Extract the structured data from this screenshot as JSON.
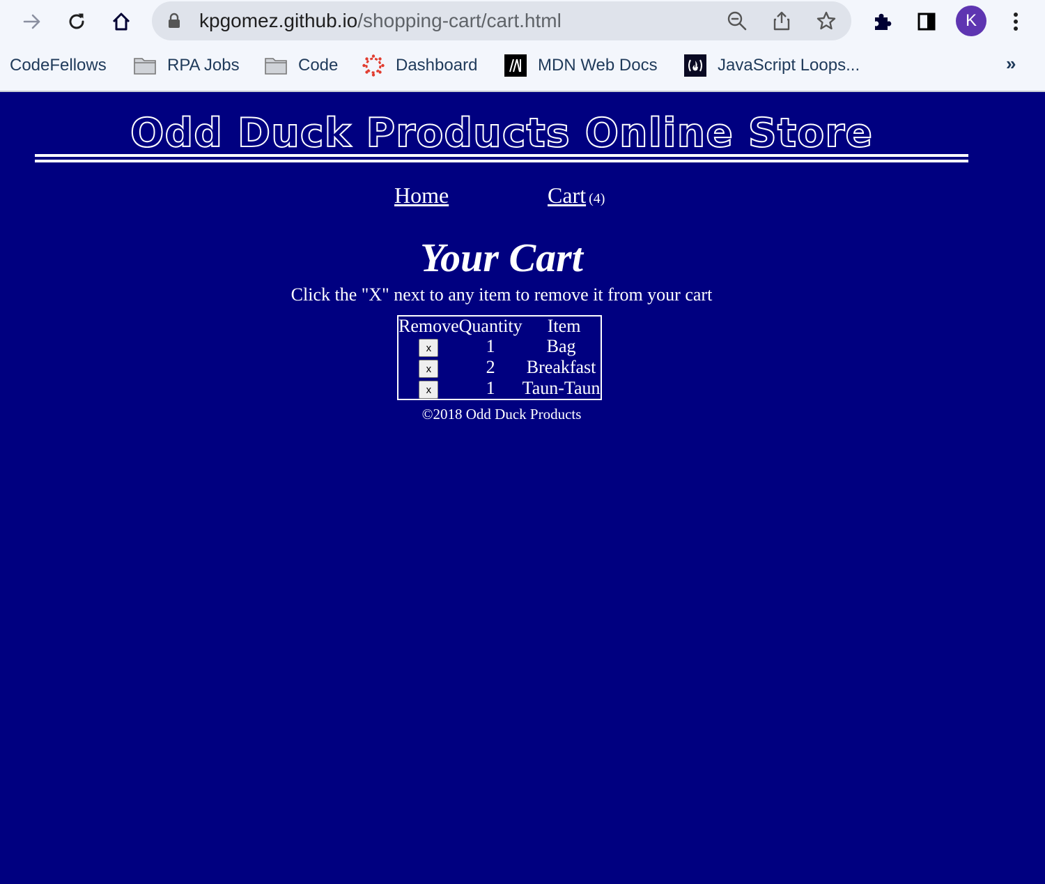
{
  "browser": {
    "url_host": "kpgomez.github.io",
    "url_path": "/shopping-cart/cart.html",
    "profile_initial": "K",
    "bookmarks": [
      {
        "label": "CodeFellows",
        "icon": "none"
      },
      {
        "label": "RPA Jobs",
        "icon": "folder-icon"
      },
      {
        "label": "Code",
        "icon": "folder-icon"
      },
      {
        "label": "Dashboard",
        "icon": "canvas-logo-icon"
      },
      {
        "label": "MDN Web Docs",
        "icon": "mdn-logo-icon"
      },
      {
        "label": "JavaScript Loops...",
        "icon": "freecodecamp-logo-icon"
      }
    ],
    "more_bookmarks": "»"
  },
  "page": {
    "banner": "Odd Duck Products Online Store",
    "nav": {
      "home": "Home",
      "cart": "Cart",
      "cart_count": "(4)"
    },
    "title": "Your Cart",
    "instructions": "Click the \"X\" next to any item to remove it from your cart",
    "table": {
      "headers": [
        "Remove",
        "Quantity",
        "Item"
      ],
      "remove_label": "x",
      "rows": [
        {
          "quantity": "1",
          "item": "Bag"
        },
        {
          "quantity": "2",
          "item": "Breakfast"
        },
        {
          "quantity": "1",
          "item": "Taun-Taun"
        }
      ]
    },
    "footer": "©2018 Odd Duck Products"
  },
  "colors": {
    "page_background": "#000080",
    "text": "#ffffff",
    "chrome_background": "#f3f6fc",
    "omnibox": "#dfe3eb",
    "avatar": "#5e35b1"
  }
}
